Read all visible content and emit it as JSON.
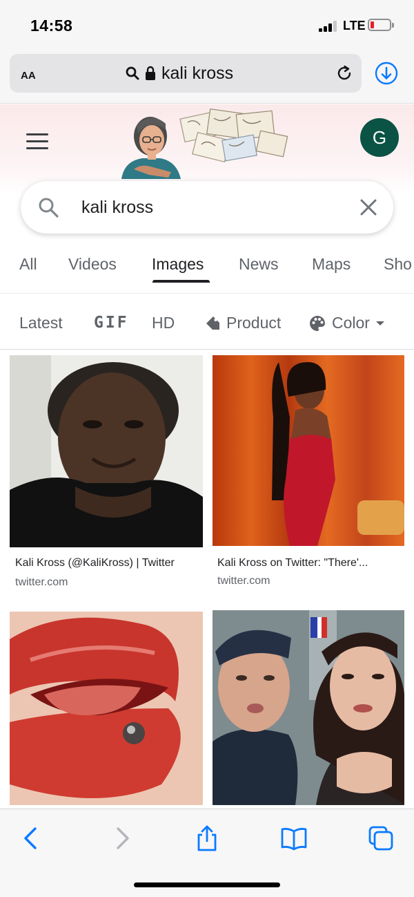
{
  "status_bar": {
    "time": "14:58",
    "network": "LTE",
    "battery_level": 0.15,
    "battery_color": "#e5212b"
  },
  "browser": {
    "text_size_label": "AA",
    "url": "kali kross",
    "icons": [
      "search-icon",
      "lock-icon",
      "reload-icon",
      "download-icon"
    ],
    "accent": "#0a7aff"
  },
  "google": {
    "account_initial": "G",
    "avatar_color": "#0b5345",
    "search_query": "kali kross",
    "tabs": [
      {
        "label": "All",
        "active": false
      },
      {
        "label": "Videos",
        "active": false
      },
      {
        "label": "Images",
        "active": true
      },
      {
        "label": "News",
        "active": false
      },
      {
        "label": "Maps",
        "active": false
      },
      {
        "label": "Sho",
        "active": false
      }
    ],
    "filters": [
      {
        "label": "Latest"
      },
      {
        "label": "GIF"
      },
      {
        "label": "HD"
      },
      {
        "label": "Product",
        "icon": "tag-icon"
      },
      {
        "label": "Color",
        "icon": "palette-icon"
      }
    ]
  },
  "results": [
    {
      "title": "Kali Kross (@KaliKross) | Twitter",
      "source": "twitter.com"
    },
    {
      "title": "Kali Kross on Twitter: \"There'...",
      "source": "twitter.com"
    },
    {
      "title": "",
      "source": ""
    },
    {
      "title": "",
      "source": ""
    }
  ],
  "toolbar": {
    "buttons": [
      "back-icon",
      "forward-icon",
      "share-icon",
      "bookmarks-icon",
      "tabs-icon"
    ]
  }
}
